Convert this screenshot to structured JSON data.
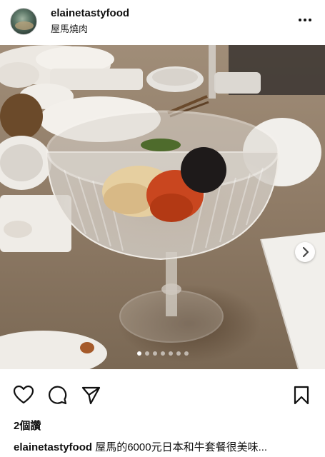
{
  "post": {
    "username": "elainetastyfood",
    "location": "屋馬燒肉",
    "likes_label": "2個讚",
    "caption_user": "elainetastyfood",
    "caption_text": " 屋馬的6000元日本和牛套餐很美味..."
  },
  "carousel": {
    "dot_count": 7,
    "active_index": 0
  },
  "icons": {
    "more": "more-options-icon",
    "like": "heart-icon",
    "comment": "comment-icon",
    "share": "paper-plane-icon",
    "save": "bookmark-icon",
    "next": "chevron-right-icon"
  }
}
